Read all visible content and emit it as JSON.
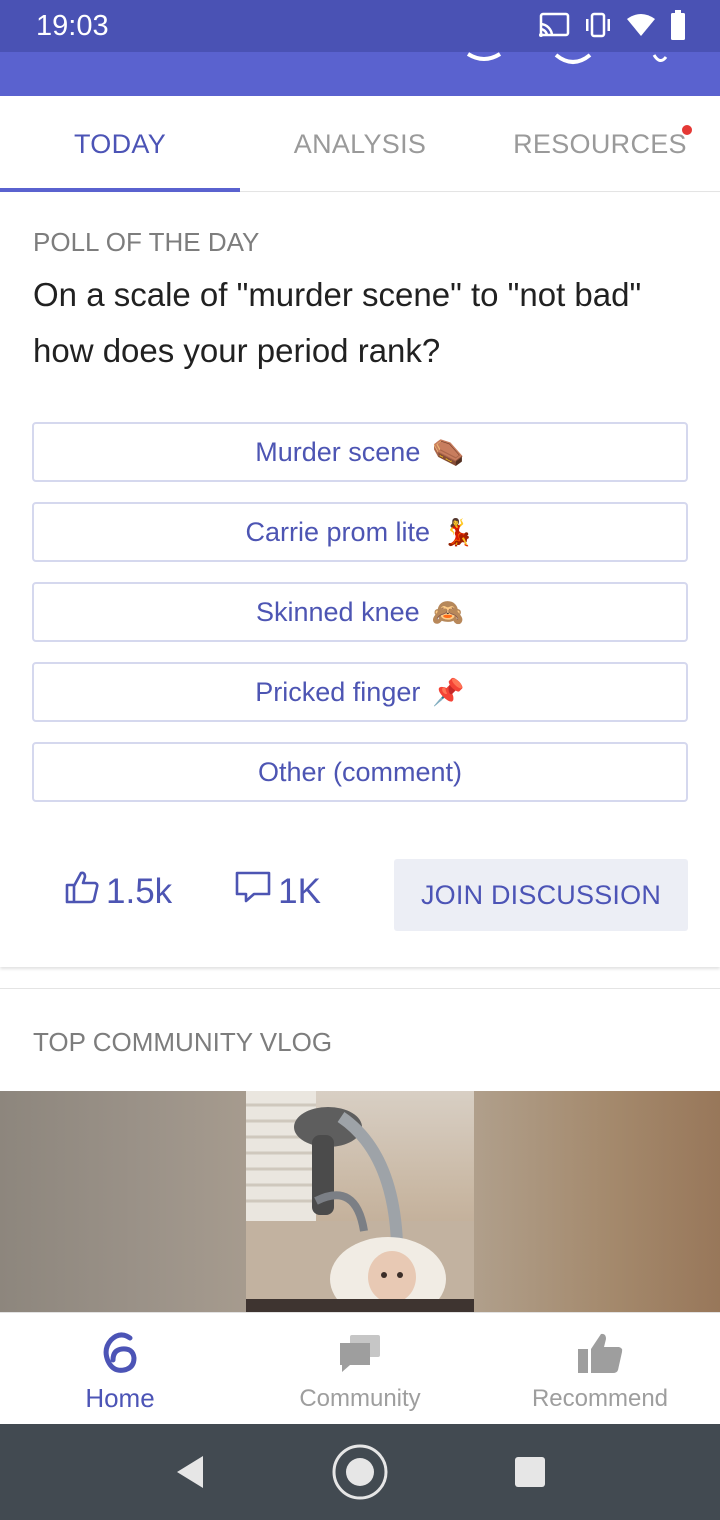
{
  "status_bar": {
    "time": "19:03",
    "icons": [
      "cast-icon",
      "vibrate-icon",
      "wifi-icon",
      "battery-icon"
    ]
  },
  "tabs": [
    {
      "label": "TODAY",
      "active": true
    },
    {
      "label": "ANALYSIS",
      "active": false
    },
    {
      "label": "RESOURCES",
      "active": false,
      "badge": true
    }
  ],
  "poll": {
    "eyebrow": "POLL OF THE DAY",
    "question": "On a scale of \"murder scene\" to \"not bad\" how does your period rank?",
    "options": [
      {
        "label": "Murder scene",
        "emoji": "⚰️"
      },
      {
        "label": "Carrie prom lite",
        "emoji": "💃"
      },
      {
        "label": "Skinned knee",
        "emoji": "🙈"
      },
      {
        "label": "Pricked finger",
        "emoji": "📌"
      },
      {
        "label": "Other (comment)",
        "emoji": ""
      }
    ],
    "likes": "1.5k",
    "comments": "1K",
    "join_label": "JOIN DISCUSSION"
  },
  "vlog": {
    "title": "TOP COMMUNITY VLOG"
  },
  "bottom_nav": [
    {
      "label": "Home",
      "icon": "home-logo-icon",
      "active": true
    },
    {
      "label": "Community",
      "icon": "chat-bubbles-icon",
      "active": false
    },
    {
      "label": "Recommend",
      "icon": "thumbs-up-icon",
      "active": false
    }
  ],
  "colors": {
    "accent": "#5a62cf",
    "status_bar": "#4a52b4",
    "link_text": "#4d55b3",
    "badge": "#e53935",
    "system_nav": "#424a51"
  }
}
